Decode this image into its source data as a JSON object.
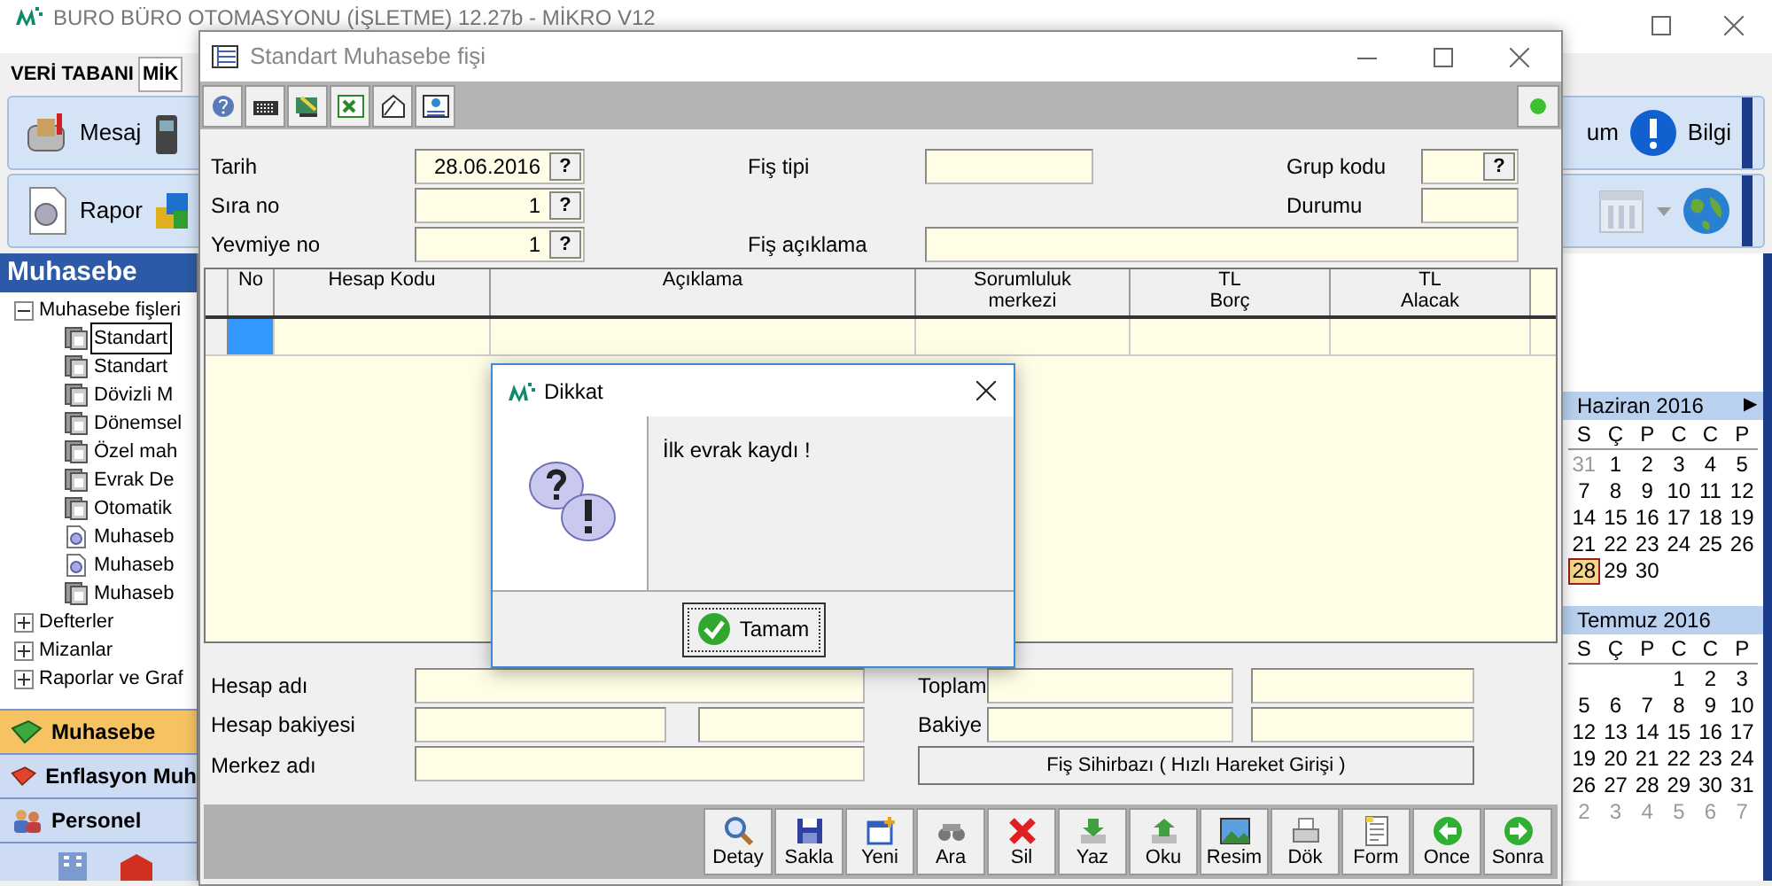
{
  "main_window": {
    "title": "BURO BÜRO OTOMASYONU (İŞLETME) 12.27b - MİKRO V12",
    "database_label": "VERİ TABANI",
    "database_value": "MİK"
  },
  "toolbar": {
    "message_button": "Mesaj",
    "partial_label": "um",
    "info_button": "Bilgi",
    "report_button": "Rapor"
  },
  "side_panel": {
    "title": "Muhasebe",
    "tree": [
      {
        "label": "Muhasebe fişleri",
        "expanded": true,
        "selected": false,
        "children": [
          {
            "label": "Standart",
            "kind": "document",
            "selected": true
          },
          {
            "label": "Standart",
            "kind": "document",
            "selected": false
          },
          {
            "label": "Dövizli M",
            "kind": "document",
            "selected": false
          },
          {
            "label": "Dönemsel",
            "kind": "document",
            "selected": false
          },
          {
            "label": "Özel mah",
            "kind": "document",
            "selected": false
          },
          {
            "label": "Evrak De",
            "kind": "document",
            "selected": false
          },
          {
            "label": "Otomatik",
            "kind": "document",
            "selected": false
          },
          {
            "label": "Muhaseb",
            "kind": "report",
            "selected": false
          },
          {
            "label": "Muhaseb",
            "kind": "report",
            "selected": false
          },
          {
            "label": "Muhaseb",
            "kind": "document",
            "selected": false
          }
        ]
      },
      {
        "label": "Defterler",
        "expanded": false,
        "selected": false
      },
      {
        "label": "Mizanlar",
        "expanded": false,
        "selected": false
      },
      {
        "label": "Raporlar ve Graf",
        "expanded": false,
        "selected": false
      }
    ],
    "nav": [
      {
        "label": "Muhasebe",
        "kind": "green-book",
        "selected": true
      },
      {
        "label": "Enflasyon Muh",
        "kind": "red-book",
        "selected": false
      },
      {
        "label": "Personel",
        "kind": "people",
        "selected": false
      }
    ]
  },
  "document_window": {
    "title": "Standart Muhasebe fişi",
    "header_fields": [
      {
        "label": "Tarih",
        "value": "28.06.2016",
        "lookup": "?"
      },
      {
        "label": "Fiş tipi"
      },
      {
        "label": "Grup kodu",
        "lookup": "?"
      },
      {
        "label": "Sıra no",
        "value": "1",
        "lookup": "?"
      },
      {
        "label": "Durumu"
      },
      {
        "label": "Yevmiye no",
        "value": "1",
        "lookup": "?"
      },
      {
        "label": "Fiş açıklama"
      }
    ],
    "grid": {
      "columns": [
        "No",
        "Hesap Kodu",
        "Açıklama",
        "Sorumluluk\nmerkezi",
        "TL\nBorç",
        "TL\nAlacak"
      ],
      "rows": [
        {
          "selected": true
        }
      ]
    },
    "footer_fields": [
      {
        "label": "Hesap adı"
      },
      {
        "label": "Toplam"
      },
      {
        "label": "Hesap bakiyesi"
      },
      {
        "label": "Bakiye"
      },
      {
        "label": "Merkez adı"
      }
    ],
    "wizard_button": "Fiş Sihirbazı ( Hızlı Hareket Girişi )",
    "actions": [
      {
        "kind": "search",
        "label": "Detay"
      },
      {
        "kind": "floppy",
        "label": "Sakla"
      },
      {
        "kind": "new",
        "label": "Yeni"
      },
      {
        "kind": "binoculars",
        "label": "Ara"
      },
      {
        "kind": "delete",
        "label": "Sil"
      },
      {
        "kind": "down",
        "label": "Yaz"
      },
      {
        "kind": "up",
        "label": "Oku"
      },
      {
        "kind": "image",
        "label": "Resim"
      },
      {
        "kind": "printer",
        "label": "Dök"
      },
      {
        "kind": "form",
        "label": "Form"
      },
      {
        "kind": "back",
        "label": "Once"
      },
      {
        "kind": "forward",
        "label": "Sonra"
      }
    ]
  },
  "dialog": {
    "title": "Dikkat",
    "message": "İlk evrak kaydı !",
    "button": "Tamam"
  },
  "calendars": [
    {
      "title": "Haziran 2016",
      "next_arrow": "▶",
      "weekdays": [
        "S",
        "Ç",
        "P",
        "C",
        "C",
        "P"
      ],
      "weeks": [
        [
          {
            "day": "31",
            "muted": true,
            "today": false
          },
          {
            "day": "1",
            "muted": false,
            "today": false
          },
          {
            "day": "2",
            "muted": false,
            "today": false
          },
          {
            "day": "3",
            "muted": false,
            "today": false
          },
          {
            "day": "4",
            "muted": false,
            "today": false
          },
          {
            "day": "5",
            "muted": false,
            "today": false
          }
        ],
        [
          {
            "day": "7",
            "muted": false,
            "today": false
          },
          {
            "day": "8",
            "muted": false,
            "today": false
          },
          {
            "day": "9",
            "muted": false,
            "today": false
          },
          {
            "day": "10",
            "muted": false,
            "today": false
          },
          {
            "day": "11",
            "muted": false,
            "today": false
          },
          {
            "day": "12",
            "muted": false,
            "today": false
          }
        ],
        [
          {
            "day": "14",
            "muted": false,
            "today": false
          },
          {
            "day": "15",
            "muted": false,
            "today": false
          },
          {
            "day": "16",
            "muted": false,
            "today": false
          },
          {
            "day": "17",
            "muted": false,
            "today": false
          },
          {
            "day": "18",
            "muted": false,
            "today": false
          },
          {
            "day": "19",
            "muted": false,
            "today": false
          }
        ],
        [
          {
            "day": "21",
            "muted": false,
            "today": false
          },
          {
            "day": "22",
            "muted": false,
            "today": false
          },
          {
            "day": "23",
            "muted": false,
            "today": false
          },
          {
            "day": "24",
            "muted": false,
            "today": false
          },
          {
            "day": "25",
            "muted": false,
            "today": false
          },
          {
            "day": "26",
            "muted": false,
            "today": false
          }
        ],
        [
          {
            "day": "28",
            "muted": false,
            "today": true
          },
          {
            "day": "29",
            "muted": false,
            "today": false
          },
          {
            "day": "30",
            "muted": false,
            "today": false
          }
        ]
      ]
    },
    {
      "title": "Temmuz 2016",
      "weekdays": [
        "S",
        "Ç",
        "P",
        "C",
        "C",
        "P"
      ],
      "weeks": [
        [
          {
            "day": "1",
            "muted": false,
            "today": false
          },
          {
            "day": "2",
            "muted": false,
            "today": false
          },
          {
            "day": "3",
            "muted": false,
            "today": false
          }
        ],
        [
          {
            "day": "5",
            "muted": false,
            "today": false
          },
          {
            "day": "6",
            "muted": false,
            "today": false
          },
          {
            "day": "7",
            "muted": false,
            "today": false
          },
          {
            "day": "8",
            "muted": false,
            "today": false
          },
          {
            "day": "9",
            "muted": false,
            "today": false
          },
          {
            "day": "10",
            "muted": false,
            "today": false
          }
        ],
        [
          {
            "day": "12",
            "muted": false,
            "today": false
          },
          {
            "day": "13",
            "muted": false,
            "today": false
          },
          {
            "day": "14",
            "muted": false,
            "today": false
          },
          {
            "day": "15",
            "muted": false,
            "today": false
          },
          {
            "day": "16",
            "muted": false,
            "today": false
          },
          {
            "day": "17",
            "muted": false,
            "today": false
          }
        ],
        [
          {
            "day": "19",
            "muted": false,
            "today": false
          },
          {
            "day": "20",
            "muted": false,
            "today": false
          },
          {
            "day": "21",
            "muted": false,
            "today": false
          },
          {
            "day": "22",
            "muted": false,
            "today": false
          },
          {
            "day": "23",
            "muted": false,
            "today": false
          },
          {
            "day": "24",
            "muted": false,
            "today": false
          }
        ],
        [
          {
            "day": "26",
            "muted": false,
            "today": false
          },
          {
            "day": "27",
            "muted": false,
            "today": false
          },
          {
            "day": "28",
            "muted": false,
            "today": false
          },
          {
            "day": "29",
            "muted": false,
            "today": false
          },
          {
            "day": "30",
            "muted": false,
            "today": false
          },
          {
            "day": "31",
            "muted": false,
            "today": false
          }
        ],
        [
          {
            "day": "2",
            "muted": true,
            "today": false
          },
          {
            "day": "3",
            "muted": true,
            "today": false
          },
          {
            "day": "4",
            "muted": true,
            "today": false
          },
          {
            "day": "5",
            "muted": true,
            "today": false
          },
          {
            "day": "6",
            "muted": true,
            "today": false
          },
          {
            "day": "7",
            "muted": true,
            "today": false
          }
        ]
      ]
    }
  ]
}
